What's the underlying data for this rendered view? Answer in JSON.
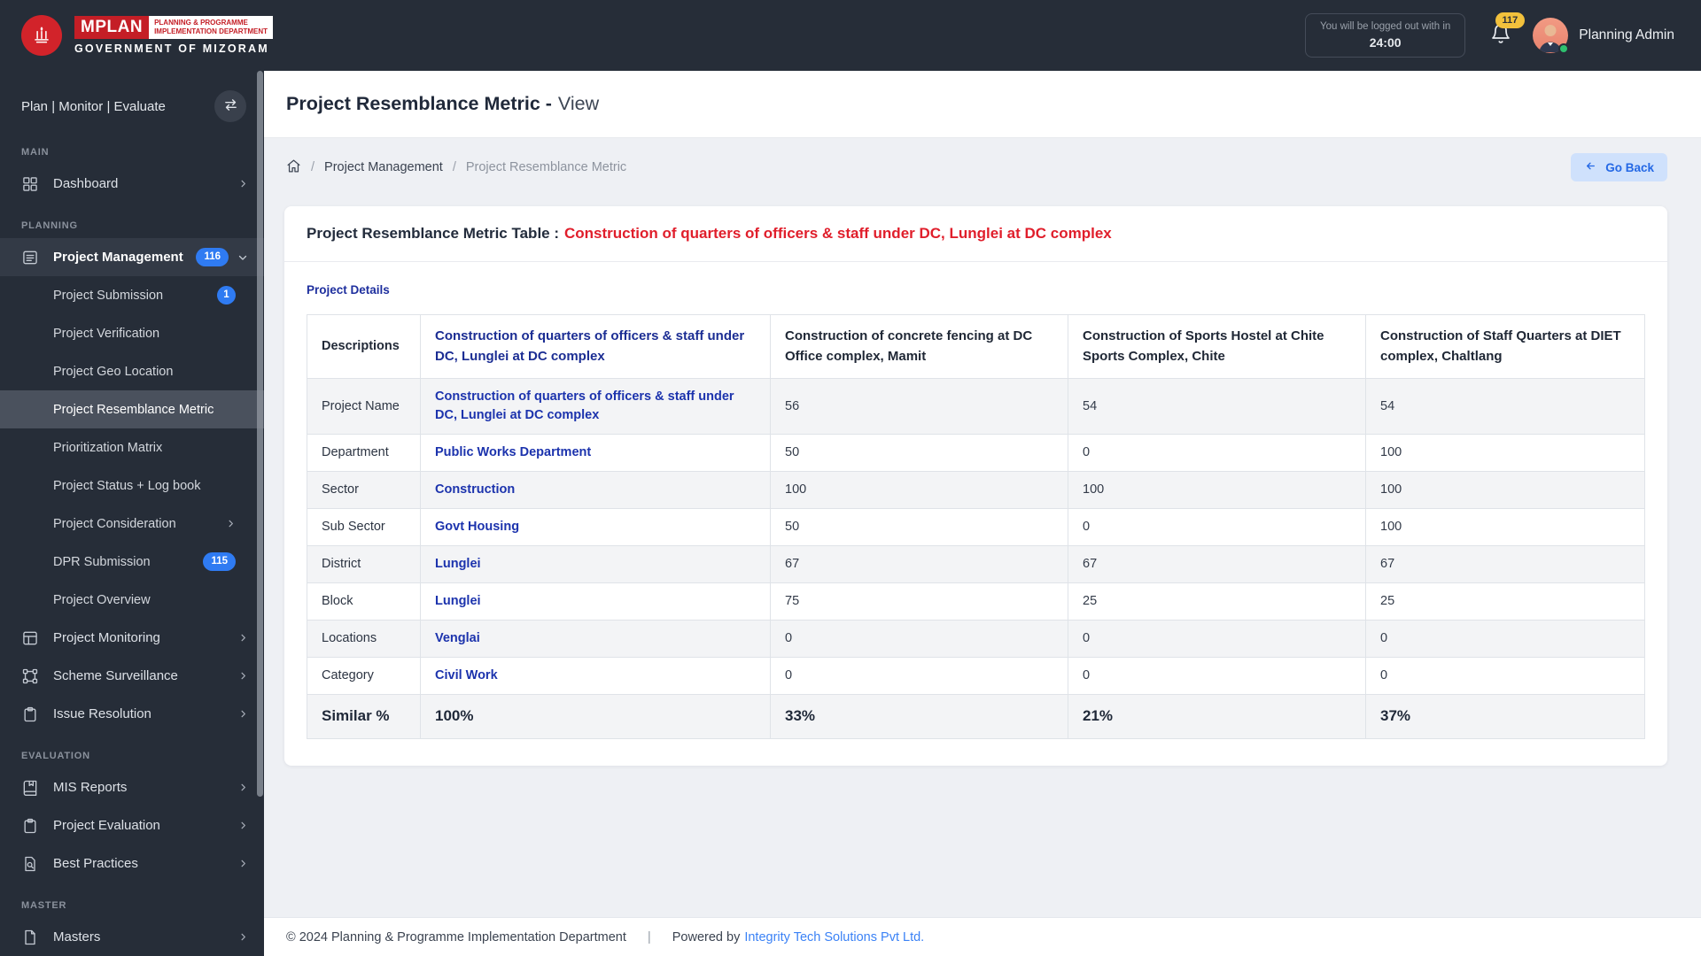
{
  "header": {
    "logo": {
      "brand": "MPLAN",
      "dept_line1": "PLANNING & PROGRAMME",
      "dept_line2": "IMPLEMENTATION DEPARTMENT",
      "govt": "GOVERNMENT OF MIZORAM"
    },
    "logout_notice": {
      "line1": "You will be logged out with in",
      "time": "24:00"
    },
    "notification_count": "117",
    "user_name": "Planning Admin"
  },
  "sidebar": {
    "tagline": "Plan | Monitor | Evaluate",
    "sections": [
      {
        "label": "MAIN",
        "items": [
          {
            "label": "Dashboard",
            "icon": "dashboard-icon",
            "chevron": "right"
          }
        ]
      },
      {
        "label": "PLANNING",
        "items": [
          {
            "label": "Project Management",
            "icon": "project-management-icon",
            "badge": "116",
            "chevron": "down",
            "open": true,
            "children": [
              {
                "label": "Project Submission",
                "badge": "1"
              },
              {
                "label": "Project Verification"
              },
              {
                "label": "Project Geo Location"
              },
              {
                "label": "Project Resemblance Metric",
                "active": true
              },
              {
                "label": "Prioritization Matrix"
              },
              {
                "label": "Project Status + Log book"
              },
              {
                "label": "Project Consideration",
                "chevron": "right"
              },
              {
                "label": "DPR Submission",
                "badge": "115"
              },
              {
                "label": "Project Overview"
              }
            ]
          },
          {
            "label": "Project Monitoring",
            "icon": "project-monitoring-icon",
            "chevron": "right"
          },
          {
            "label": "Scheme Surveillance",
            "icon": "scheme-surveillance-icon",
            "chevron": "right"
          },
          {
            "label": "Issue Resolution",
            "icon": "issue-resolution-icon",
            "chevron": "right"
          }
        ]
      },
      {
        "label": "EVALUATION",
        "items": [
          {
            "label": "MIS Reports",
            "icon": "mis-reports-icon",
            "chevron": "right"
          },
          {
            "label": "Project Evaluation",
            "icon": "project-evaluation-icon",
            "chevron": "right"
          },
          {
            "label": "Best Practices",
            "icon": "best-practices-icon",
            "chevron": "right"
          }
        ]
      },
      {
        "label": "MASTER",
        "items": [
          {
            "label": "Masters",
            "icon": "masters-icon",
            "chevron": "right"
          }
        ]
      }
    ]
  },
  "page": {
    "title": "Project Resemblance Metric -",
    "title_suffix": "View"
  },
  "breadcrumb": {
    "separator": "/",
    "items": [
      "Project Management",
      "Project Resemblance Metric"
    ],
    "go_back_label": "Go Back"
  },
  "card": {
    "heading_prefix": "Project Resemblance Metric Table :",
    "heading_project": "Construction of quarters of officers & staff under DC, Lunglei at DC complex",
    "section_label": "Project Details"
  },
  "table": {
    "columns": [
      "Descriptions",
      "Construction of quarters of officers & staff under DC, Lunglei at DC complex",
      "Construction of concrete fencing at DC Office complex, Mamit",
      "Construction of Sports Hostel at Chite Sports Complex, Chite",
      "Construction of Staff Quarters at DIET complex, Chaltlang"
    ],
    "rows": [
      {
        "label": "Project Name",
        "base_value": "Construction of quarters of officers & staff under DC, Lunglei at DC complex",
        "values": [
          "56",
          "54",
          "54"
        ]
      },
      {
        "label": "Department",
        "base_value": "Public Works Department",
        "values": [
          "50",
          "0",
          "100"
        ]
      },
      {
        "label": "Sector",
        "base_value": "Construction",
        "values": [
          "100",
          "100",
          "100"
        ]
      },
      {
        "label": "Sub Sector",
        "base_value": "Govt Housing",
        "values": [
          "50",
          "0",
          "100"
        ]
      },
      {
        "label": "District",
        "base_value": "Lunglei",
        "values": [
          "67",
          "67",
          "67"
        ]
      },
      {
        "label": "Block",
        "base_value": "Lunglei",
        "values": [
          "75",
          "25",
          "25"
        ]
      },
      {
        "label": "Locations",
        "base_value": "Venglai",
        "values": [
          "0",
          "0",
          "0"
        ]
      },
      {
        "label": "Category",
        "base_value": "Civil Work",
        "values": [
          "0",
          "0",
          "0"
        ]
      }
    ],
    "summary_row": {
      "label": "Similar %",
      "values": [
        "100%",
        "33%",
        "21%",
        "37%"
      ]
    }
  },
  "footer": {
    "copyright": "© 2024 Planning & Programme Implementation Department",
    "separator": "|",
    "powered_prefix": "Powered by",
    "powered_link": "Integrity Tech Solutions Pvt Ltd."
  },
  "colors": {
    "accent_blue": "#2f7bf2",
    "link_navy": "#1c33ad",
    "heading_red": "#e01e2b",
    "sidebar_bg": "#262d38",
    "active_item_bg": "#4a515d",
    "badge_yellow": "#f2c13c",
    "online_green": "#2ec06f"
  }
}
